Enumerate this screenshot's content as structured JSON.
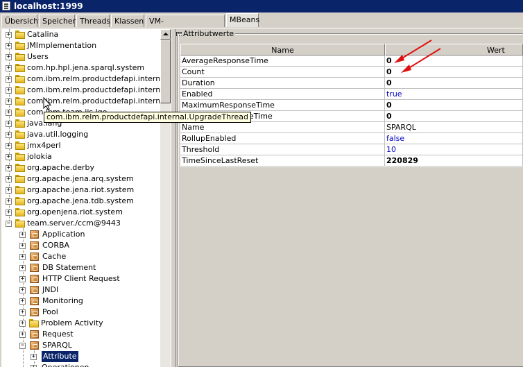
{
  "window": {
    "title": "localhost:1999"
  },
  "tabs": [
    "Übersicht",
    "Speicher",
    "Threads",
    "Klassen",
    "VM-Zusammenfassung",
    "MBeans"
  ],
  "tree": {
    "items": [
      {
        "label": "Catalina",
        "icon": "folder-icon",
        "expander": "+",
        "level": 0
      },
      {
        "label": "JMImplementation",
        "icon": "folder-icon",
        "expander": "+",
        "level": 0
      },
      {
        "label": "Users",
        "icon": "folder-icon",
        "expander": "+",
        "level": 0
      },
      {
        "label": "com.hp.hpl.jena.sparql.system",
        "icon": "folder-icon",
        "expander": "+",
        "level": 0
      },
      {
        "label": "com.ibm.relm.productdefapi.internal.St",
        "icon": "folder-icon",
        "expander": "+",
        "level": 0
      },
      {
        "label": "com.ibm.relm.productdefapi.internal.Tr",
        "icon": "folder-icon",
        "expander": "+",
        "level": 0
      },
      {
        "label": "com.ibm.relm.productdefapi.internal.Up",
        "icon": "folder-icon",
        "expander": "+",
        "level": 0
      },
      {
        "label": "com.ibm.team.jis.lqe",
        "icon": "folder-icon",
        "expander": "+",
        "level": 0
      },
      {
        "label": "java.lang",
        "icon": "folder-icon",
        "expander": "+",
        "level": 0
      },
      {
        "label": "java.util.logging",
        "icon": "folder-icon",
        "expander": "+",
        "level": 0
      },
      {
        "label": "jmx4perl",
        "icon": "folder-icon",
        "expander": "+",
        "level": 0
      },
      {
        "label": "jolokia",
        "icon": "folder-icon",
        "expander": "+",
        "level": 0
      },
      {
        "label": "org.apache.derby",
        "icon": "folder-icon",
        "expander": "+",
        "level": 0
      },
      {
        "label": "org.apache.jena.arq.system",
        "icon": "folder-icon",
        "expander": "+",
        "level": 0
      },
      {
        "label": "org.apache.jena.riot.system",
        "icon": "folder-icon",
        "expander": "+",
        "level": 0
      },
      {
        "label": "org.apache.jena.tdb.system",
        "icon": "folder-icon",
        "expander": "+",
        "level": 0
      },
      {
        "label": "org.openjena.riot.system",
        "icon": "folder-icon",
        "expander": "+",
        "level": 0
      },
      {
        "label": "team.server./ccm@9443",
        "icon": "folder-icon",
        "expander": "−",
        "level": 0
      },
      {
        "label": "Application",
        "icon": "mbean-icon",
        "expander": "+",
        "level": 1
      },
      {
        "label": "CORBA",
        "icon": "mbean-icon",
        "expander": "+",
        "level": 1
      },
      {
        "label": "Cache",
        "icon": "mbean-icon",
        "expander": "+",
        "level": 1
      },
      {
        "label": "DB Statement",
        "icon": "mbean-icon",
        "expander": "+",
        "level": 1
      },
      {
        "label": "HTTP Client Request",
        "icon": "mbean-icon",
        "expander": "+",
        "level": 1
      },
      {
        "label": "JNDI",
        "icon": "mbean-icon",
        "expander": "+",
        "level": 1
      },
      {
        "label": "Monitoring",
        "icon": "mbean-icon",
        "expander": "+",
        "level": 1
      },
      {
        "label": "Pool",
        "icon": "mbean-icon",
        "expander": "+",
        "level": 1
      },
      {
        "label": "Problem Activity",
        "icon": "folder-icon",
        "expander": "+",
        "level": 1
      },
      {
        "label": "Request",
        "icon": "mbean-icon",
        "expander": "+",
        "level": 1
      },
      {
        "label": "SPARQL",
        "icon": "mbean-icon",
        "expander": "−",
        "level": 1
      },
      {
        "label": "Attribute",
        "icon": "none",
        "expander": "+",
        "level": 2,
        "selected": true
      },
      {
        "label": "Operationen",
        "icon": "none",
        "expander": "+",
        "level": 2
      }
    ]
  },
  "tooltip": "com.ibm.relm.productdefapi.internal.UpgradeThread",
  "attributes": {
    "legend": "Attributwerte",
    "columns": [
      "Name",
      "Wert"
    ],
    "rows": [
      {
        "name": "AverageResponseTime",
        "value": "0",
        "style": "bold"
      },
      {
        "name": "Count",
        "value": "0",
        "style": "bold"
      },
      {
        "name": "Duration",
        "value": "0",
        "style": "bold"
      },
      {
        "name": "Enabled",
        "value": "true",
        "style": "blue"
      },
      {
        "name": "MaximumResponseTime",
        "value": "0",
        "style": "bold"
      },
      {
        "name": "MinimumResponseTime",
        "value": "0",
        "style": "bold"
      },
      {
        "name": "Name",
        "value": "SPARQL",
        "style": "plain"
      },
      {
        "name": "RollupEnabled",
        "value": "false",
        "style": "blue"
      },
      {
        "name": "Threshold",
        "value": "10",
        "style": "blue"
      },
      {
        "name": "TimeSinceLastReset",
        "value": "220829",
        "style": "bold"
      }
    ]
  },
  "colors": {
    "title_bar": "#0a246a",
    "selection": "#0a246a",
    "annotation_arrow": "#e01010",
    "blue_value": "#0000c0"
  }
}
